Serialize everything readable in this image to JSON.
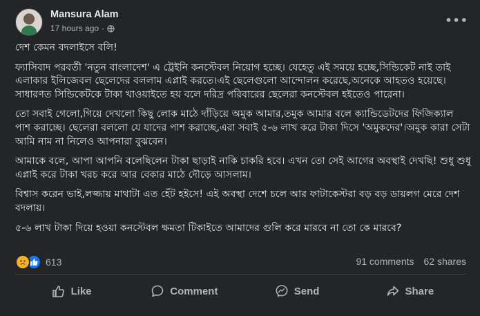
{
  "post": {
    "author": "Mansura Alam",
    "time": "17 hours ago",
    "privacy_separator": "·",
    "paragraphs": [
      "দেশ কেমন বদলাইসে বলি!",
      "ফ্যাসিবাদ পরবর্তী 'নতুন বাংলাদেশ' এ ট্রেইনি কনস্টেবল নিয়োগ হচ্ছে। যেহেতু এই সময়ে হচ্ছে,সিন্ডিকেট নাই তাই এলাকার ইলিজেবল ছেলেদের বললাম এপ্লাই করতে।এই ছেলেগুলো আন্দোলন করেছে,অনেকে আহতও হয়েছে। সাধারণত সিন্ডিকেটকে টাকা খাওয়াইতে হয় বলে দরিদ্র পরিবারের ছেলেরা কনস্টেবল হইতেও পারেনা।",
      "তো সবাই গেলো,গিয়ে দেখলো কিছু লোক মাঠে দাঁড়িয়ে অমুক আমার,তমুক আমার বলে ক্যান্ডিডেটদের ফিজিক্যাল পাশ করাচ্ছে। ছেলেরা বললো যে যাদের পাশ করাচ্ছে,এরা সবাই ৫-৬ লাখ করে টাকা দিসে 'অমুকদের'।অমুক কারা সেটা আমি নাম না নিলেও আপনারা বুঝবেন।",
      "আমাকে বলে, আপা আপনি বলেছিলেন টাকা ছাড়াই নাকি চাকরি হবে। এখন তো সেই আগের অবস্থাই দেখছি! শুধু শুধু এপ্লাই করে টাকা খরচ করে আর বেকার মাঠে দৌড়ে আসলাম।",
      "বিশ্বাস করেন ভাই,লজ্জায় মাথাটা এত হেঁট হইসে! এই অবস্থা দেশে চলে আর ফাটাকেস্টরা বড় বড় ডায়লগ মেরে দেশ বদলায়।",
      "৫-৬ লাখ টাকা দিয়ে হওয়া কনস্টেবল ক্ষমতা টিকাইতে আমাদের গুলি করে মারবে না তো কে মারবে?"
    ]
  },
  "stats": {
    "reactions": "613",
    "comments": "91 comments",
    "shares": "62 shares"
  },
  "actions": {
    "like": "Like",
    "comment": "Comment",
    "send": "Send",
    "share": "Share"
  },
  "icons": {
    "more": "more-options-icon",
    "privacy": "globe-icon",
    "reaction_1": "sad-reaction-icon",
    "reaction_2": "like-reaction-icon"
  },
  "colors": {
    "background": "#242526",
    "text": "#e4e6eb",
    "secondary_text": "#b0b3b8",
    "like_blue": "#1877f2",
    "sad_yellow": "#f7b125"
  }
}
